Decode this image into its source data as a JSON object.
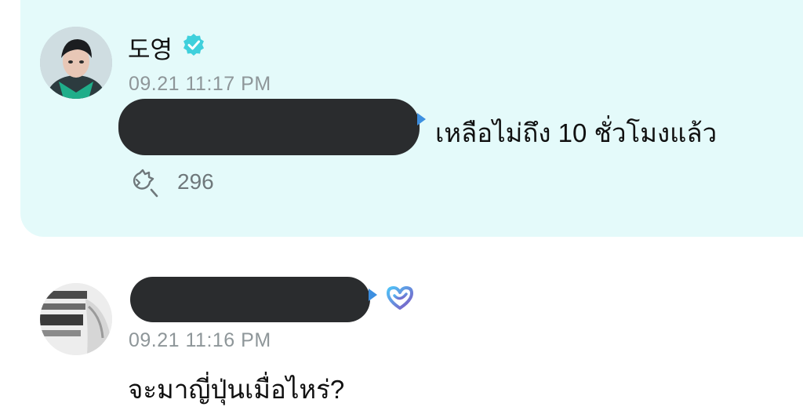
{
  "artist_post": {
    "author_name": "도영",
    "verified_icon": "verified-check-icon",
    "timestamp": "09.21 11:17 PM",
    "text": "เหลือไม่ถึง 10 ชั่วโมงแล้ว",
    "reply_icon": "reply-bubble-icon",
    "reply_count": "296",
    "background_color": "#e4fafa"
  },
  "fan_comment": {
    "timestamp": "09.21 11:16 PM",
    "text": "จะมาญี่ปุ่นเมื่อไหร่?",
    "membership_icon": "membership-heart-icon"
  },
  "colors": {
    "verified": "#3fd0dc",
    "membership_gradient": [
      "#4fc3f7",
      "#7e57c2"
    ],
    "redaction": "#2a2c2e",
    "mention_arrow": "#3d8fe0"
  }
}
